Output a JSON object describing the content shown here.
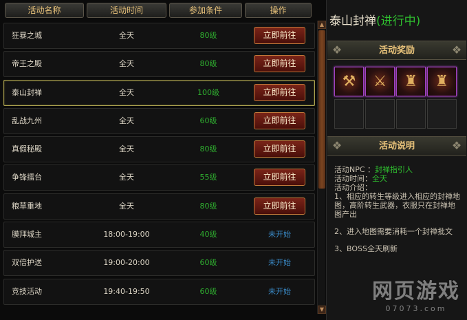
{
  "table": {
    "headers": [
      "活动名称",
      "活动时间",
      "参加条件",
      "操作"
    ],
    "rows": [
      {
        "name": "狂暴之城",
        "time": "全天",
        "cond": "80级",
        "action": "立即前往"
      },
      {
        "name": "帝王之殿",
        "time": "全天",
        "cond": "80级",
        "action": "立即前往"
      },
      {
        "name": "泰山封禅",
        "time": "全天",
        "cond": "100级",
        "action": "立即前往"
      },
      {
        "name": "乱战九州",
        "time": "全天",
        "cond": "60级",
        "action": "立即前往"
      },
      {
        "name": "真假秘殿",
        "time": "全天",
        "cond": "80级",
        "action": "立即前往"
      },
      {
        "name": "争锋擂台",
        "time": "全天",
        "cond": "55级",
        "action": "立即前往"
      },
      {
        "name": "粮草重地",
        "time": "全天",
        "cond": "80级",
        "action": "立即前往"
      },
      {
        "name": "膜拜城主",
        "time": "18:00-19:00",
        "cond": "40级",
        "action": "未开始"
      },
      {
        "name": "双倍护送",
        "time": "19:00-20:00",
        "cond": "60级",
        "action": "未开始"
      },
      {
        "name": "竞技活动",
        "time": "19:40-19:50",
        "cond": "60级",
        "action": "未开始"
      }
    ],
    "selected_index": 2
  },
  "panel": {
    "title": "泰山封禅",
    "status": "(进行中)",
    "reward_header": "活动奖励",
    "desc_header": "活动说明",
    "npc_label": "活动NPC ：",
    "npc_value": "封禅指引人",
    "time_label": "活动时间：",
    "time_value": "全天",
    "intro_label": "活动介绍：",
    "intro_1": "1、相应的转生等级进入相应的封禅地图，高阶转生武器，衣服只在封禅地图产出",
    "intro_2": "2、进入地图需要消耗一个封禅批文",
    "intro_3": "3、BOSS全天刷新"
  },
  "reward_items": [
    "axe-icon",
    "spear-icon",
    "armor-icon",
    "armor-icon"
  ],
  "watermark": {
    "big": "网页游戏",
    "small": "07073.com"
  }
}
